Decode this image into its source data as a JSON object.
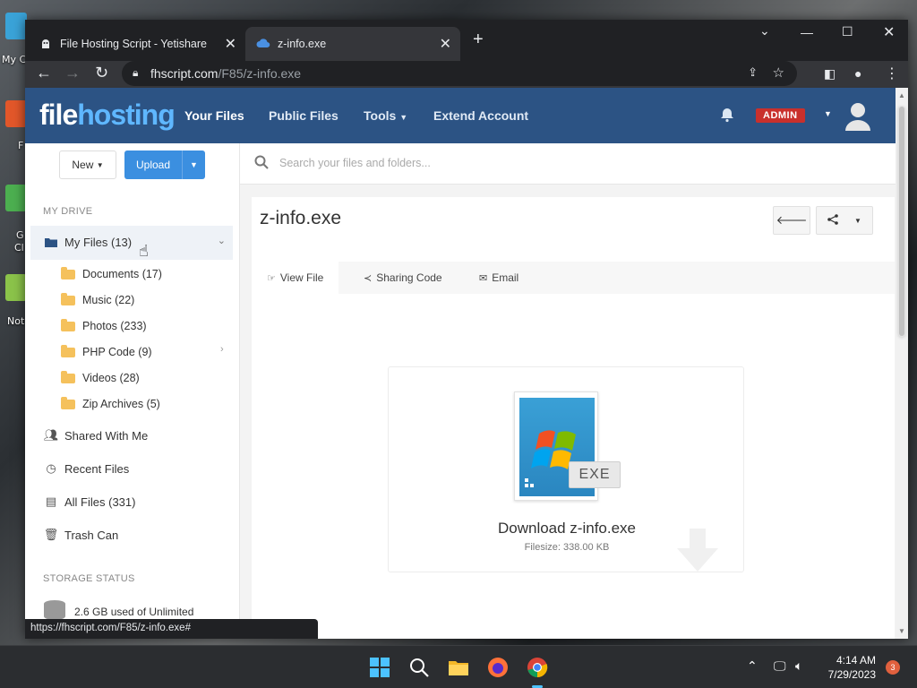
{
  "browser": {
    "tabs": [
      {
        "title": "File Hosting Script - Yetishare"
      },
      {
        "title": "z-info.exe"
      }
    ],
    "url_host": "fhscript.com",
    "url_path": "/F85/z-info.exe",
    "status_url": "https://fhscript.com/F85/z-info.exe#"
  },
  "header": {
    "logo_part1": "file",
    "logo_part2": "hosting",
    "nav": [
      "Your Files",
      "Public Files",
      "Tools",
      "Extend Account"
    ],
    "admin_badge": "ADMIN"
  },
  "sidebar": {
    "new_label": "New",
    "upload_label": "Upload",
    "my_drive_heading": "MY DRIVE",
    "my_files": "My Files (13)",
    "folders": [
      "Documents (17)",
      "Music (22)",
      "Photos (233)",
      "PHP Code (9)",
      "Videos (28)",
      "Zip Archives (5)"
    ],
    "items": [
      "Shared With Me",
      "Recent Files",
      "All Files (331)",
      "Trash Can"
    ],
    "storage_heading": "STORAGE STATUS",
    "storage_text": "2.6 GB used of Unlimited"
  },
  "search": {
    "placeholder": "Search your files and folders..."
  },
  "file": {
    "title": "z-info.exe",
    "tabs": [
      "View File",
      "Sharing Code",
      "Email"
    ],
    "ext": "EXE",
    "download_label": "Download z-info.exe",
    "filesize": "Filesize: 338.00 KB"
  },
  "taskbar": {
    "time": "4:14 AM",
    "date": "7/29/2023",
    "notification_count": "3"
  },
  "desktop": {
    "icon_labels": [
      "My C",
      "F",
      "G",
      "Cl",
      "Not"
    ]
  },
  "colors": {
    "header": "#2c5384",
    "upload": "#3b8fe0",
    "admin": "#c9302c",
    "logo_accent": "#5fb7ff"
  }
}
